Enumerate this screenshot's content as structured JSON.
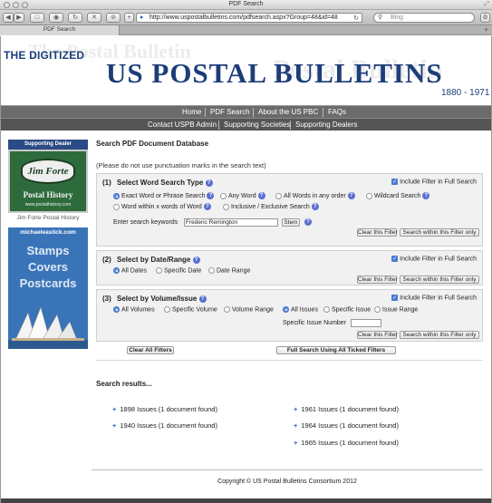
{
  "window": {
    "title": "PDF Search"
  },
  "browser": {
    "back_icon": "back-arrow-icon",
    "forward_icon": "forward-arrow-icon",
    "url": "http://www.uspostalbulletins.com/pdfsearch.aspx?Group=48&id=48",
    "search_placeholder": "Bing",
    "tab_label": "PDF Search"
  },
  "banner": {
    "digitized": "THE DIGITIZED",
    "title": "US POSTAL BULLETINS",
    "years": "1880 - 1971",
    "bg_words": [
      "The Postal Bulletin",
      "Postal Bulletin"
    ]
  },
  "nav": {
    "row1": [
      "Home",
      "PDF Search",
      "About the US PBC",
      "FAQs"
    ],
    "row2": [
      "Contact USPB Admin",
      "Supporting Societies",
      "Supporting Dealers"
    ]
  },
  "sidebar": {
    "dealer_heading": "Supporting Dealer",
    "dealer_logo": "Jim Forte",
    "dealer_tag": "Postal History",
    "dealer_url": "www.postalhistory.com",
    "dealer_caption": "Jim Forte Postal History",
    "ad_site": "michaeleastick.com",
    "ad_words": [
      "Stamps",
      "Covers",
      "Postcards"
    ]
  },
  "main": {
    "title": "Search PDF Document Database",
    "notice": "(Please do not use punctuation marks in the search text)",
    "include_filter_label": "Include Filter in Full Search",
    "clear_filter_label": "Clear this Filter",
    "search_within_label": "Search within this Filter only",
    "help_glyph": "?",
    "word": {
      "num": "(1)",
      "heading": "Select Word Search Type",
      "options": [
        "Exact Word or Phrase Search",
        "Any Word",
        "All Words in any order",
        "Wildcard Search",
        "Word within x words of Word",
        "Inclusive / Exclusive Search"
      ],
      "selected": "Exact Word or Phrase Search",
      "keywords_label": "Enter search keywords",
      "keywords_value": "Frederic Remington",
      "stem_label": "Stem"
    },
    "date": {
      "num": "(2)",
      "heading": "Select by Date/Range",
      "options": [
        "All Dates",
        "Specific Date",
        "Date Range"
      ],
      "selected": "All Dates"
    },
    "volume": {
      "num": "(3)",
      "heading": "Select by Volume/Issue",
      "options": [
        "All Volumes",
        "Specific Volume",
        "Volume Range"
      ],
      "issue_options": [
        "All Issues",
        "Specific Issue",
        "Issue Range"
      ],
      "selected": "All Volumes",
      "issue_selected": "All Issues",
      "issue_number_label": "Specific Issue Number",
      "issue_number_value": ""
    },
    "clear_all_label": "Clear All Filters",
    "full_search_label": "Full Search Using All Ticked Filters"
  },
  "results": {
    "title": "Search results...",
    "bullet_glyph": "+",
    "items": [
      "1898 Issues (1 document found)",
      "1961 Issues (1 document found)",
      "1940 Issues (1 document found)",
      "1964 Issues (1 document found)",
      "1965 Issues (1 document found)"
    ]
  },
  "footer": {
    "copyright": "Copyright © US Postal Bulletins Consortium 2012"
  }
}
